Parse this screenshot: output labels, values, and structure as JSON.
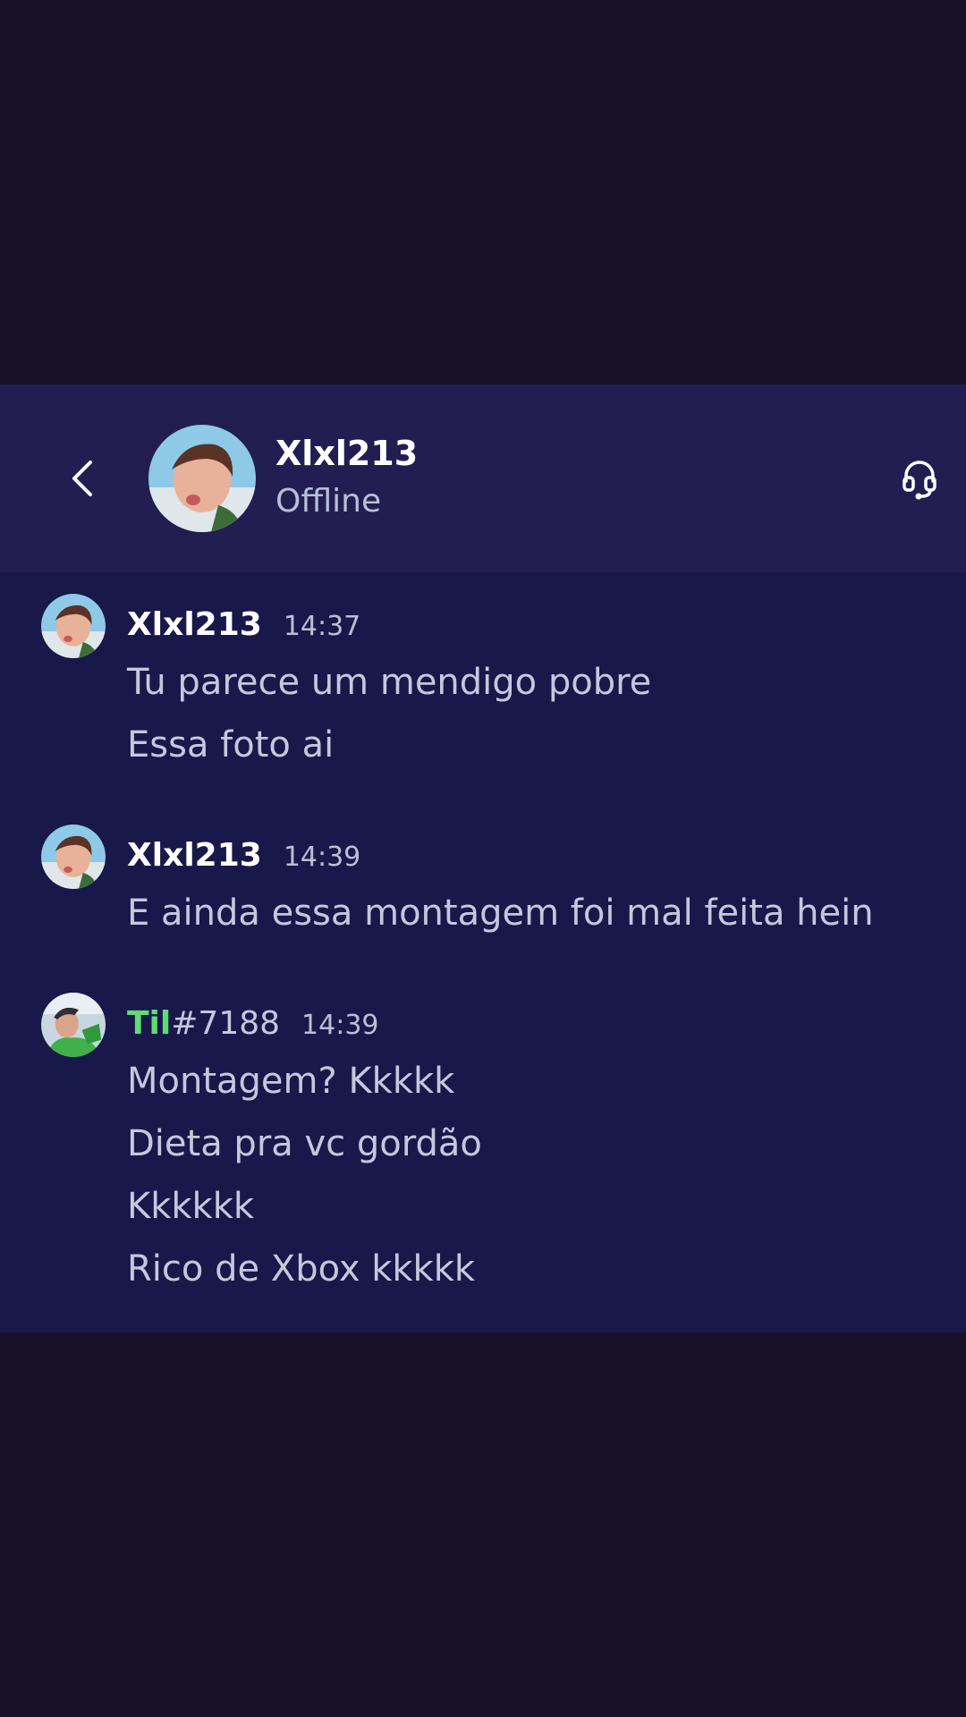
{
  "header": {
    "back_icon": "chevron-left-icon",
    "name": "Xlxl213",
    "status": "Offline",
    "call_icon": "headset-icon"
  },
  "messages": [
    {
      "author": "Xlxl213",
      "time": "14:37",
      "lines": [
        "Tu parece um mendigo pobre",
        "Essa foto ai"
      ]
    },
    {
      "author": "Xlxl213",
      "time": "14:39",
      "lines": [
        "E ainda essa montagem foi mal feita hein"
      ]
    },
    {
      "author": "Til",
      "discriminator": "#7188",
      "time": "14:39",
      "author_color": "#5fdc72",
      "lines": [
        "Montagem? Kkkkk",
        "Dieta pra vc gordão",
        "Kkkkkk",
        "Rico de Xbox kkkkk"
      ]
    }
  ],
  "colors": {
    "header_bg": "#231e52",
    "chat_bg": "#19184a",
    "letterbox_bg": "#161126"
  }
}
